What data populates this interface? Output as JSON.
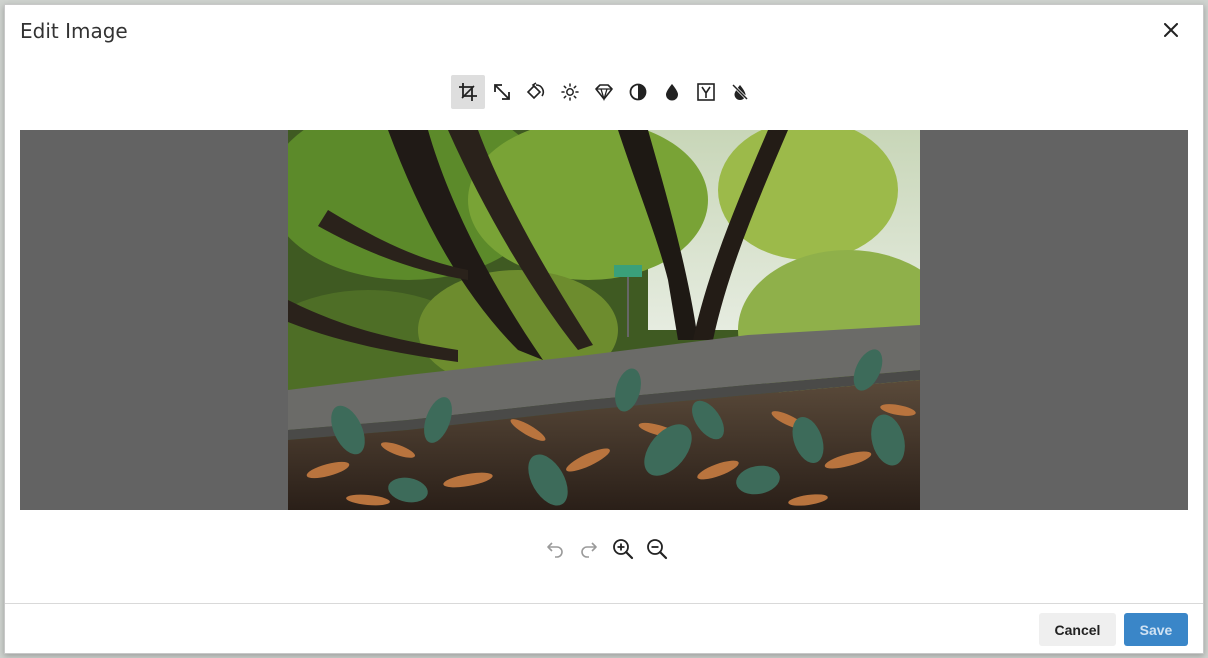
{
  "dialog": {
    "title": "Edit Image",
    "close_icon": "close-icon"
  },
  "toolbar": {
    "tools": [
      {
        "name": "crop",
        "icon": "crop-icon",
        "active": true
      },
      {
        "name": "resize",
        "icon": "resize-icon",
        "active": false
      },
      {
        "name": "rotate",
        "icon": "rotate-icon",
        "active": false
      },
      {
        "name": "brightness",
        "icon": "brightness-icon",
        "active": false
      },
      {
        "name": "sharpen",
        "icon": "gem-icon",
        "active": false
      },
      {
        "name": "contrast",
        "icon": "contrast-icon",
        "active": false
      },
      {
        "name": "color",
        "icon": "droplet-icon",
        "active": false
      },
      {
        "name": "gamma",
        "icon": "gamma-icon",
        "active": false
      },
      {
        "name": "invert",
        "icon": "invert-icon",
        "active": false
      }
    ],
    "active_color": "#dedede"
  },
  "canvas": {
    "background": "#636363",
    "image_description_icon": "photo-of-plants-and-trees"
  },
  "zoom_controls": {
    "undo_icon": "undo-icon",
    "redo_icon": "redo-icon",
    "zoom_in_icon": "zoom-in-icon",
    "zoom_out_icon": "zoom-out-icon"
  },
  "footer": {
    "cancel_label": "Cancel",
    "save_label": "Save",
    "save_color": "#3a86c8"
  }
}
